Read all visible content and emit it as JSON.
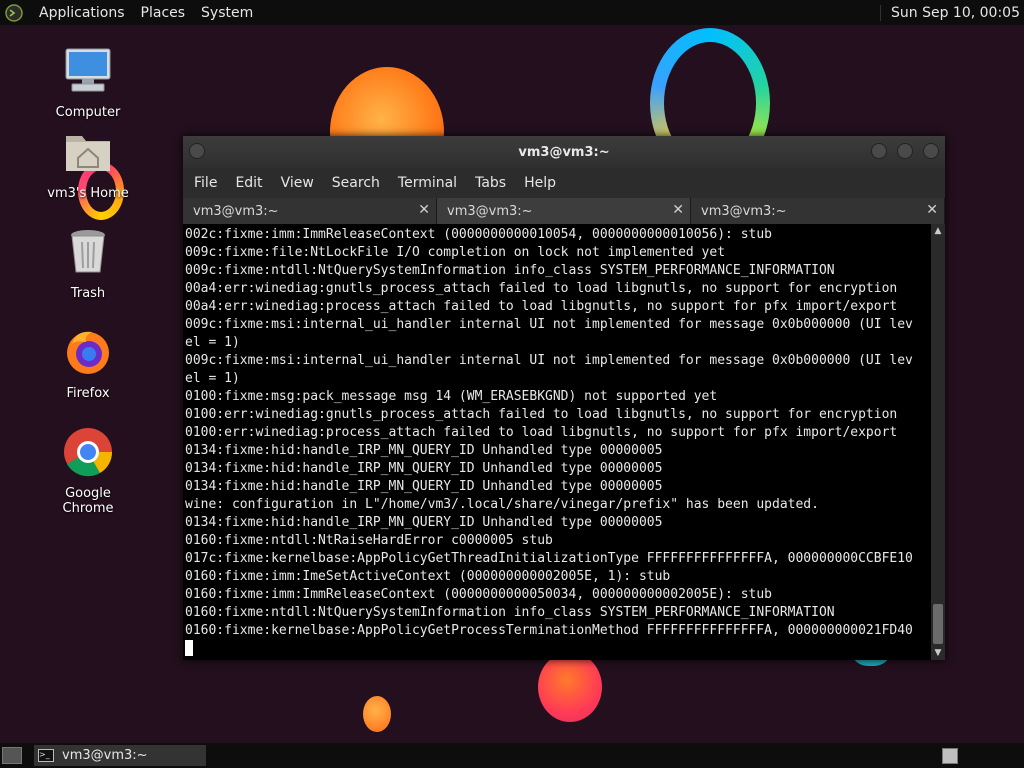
{
  "top_panel": {
    "menus": [
      "Applications",
      "Places",
      "System"
    ],
    "clock": "Sun Sep 10, 00:05"
  },
  "desktop_icons": [
    {
      "label": "Computer",
      "icon": "computer-icon"
    },
    {
      "label": "vm3's Home",
      "icon": "home-folder-icon"
    },
    {
      "label": "Trash",
      "icon": "trash-icon"
    },
    {
      "label": "Firefox",
      "icon": "firefox-icon"
    },
    {
      "label": "Google Chrome",
      "icon": "chrome-icon"
    }
  ],
  "window": {
    "title": "vm3@vm3:~",
    "menus": [
      "File",
      "Edit",
      "View",
      "Search",
      "Terminal",
      "Tabs",
      "Help"
    ],
    "tabs": [
      {
        "label": "vm3@vm3:~",
        "active": false
      },
      {
        "label": "vm3@vm3:~",
        "active": true
      },
      {
        "label": "vm3@vm3:~",
        "active": false
      }
    ],
    "terminal_lines": [
      "002c:fixme:imm:ImmReleaseContext (0000000000010054, 0000000000010056): stub",
      "009c:fixme:file:NtLockFile I/O completion on lock not implemented yet",
      "009c:fixme:ntdll:NtQuerySystemInformation info_class SYSTEM_PERFORMANCE_INFORMATION",
      "00a4:err:winediag:gnutls_process_attach failed to load libgnutls, no support for encryption",
      "00a4:err:winediag:process_attach failed to load libgnutls, no support for pfx import/export",
      "009c:fixme:msi:internal_ui_handler internal UI not implemented for message 0x0b000000 (UI lev",
      "el = 1)",
      "009c:fixme:msi:internal_ui_handler internal UI not implemented for message 0x0b000000 (UI lev",
      "el = 1)",
      "0100:fixme:msg:pack_message msg 14 (WM_ERASEBKGND) not supported yet",
      "0100:err:winediag:gnutls_process_attach failed to load libgnutls, no support for encryption",
      "0100:err:winediag:process_attach failed to load libgnutls, no support for pfx import/export",
      "0134:fixme:hid:handle_IRP_MN_QUERY_ID Unhandled type 00000005",
      "0134:fixme:hid:handle_IRP_MN_QUERY_ID Unhandled type 00000005",
      "0134:fixme:hid:handle_IRP_MN_QUERY_ID Unhandled type 00000005",
      "wine: configuration in L\"/home/vm3/.local/share/vinegar/prefix\" has been updated.",
      "0134:fixme:hid:handle_IRP_MN_QUERY_ID Unhandled type 00000005",
      "0160:fixme:ntdll:NtRaiseHardError c0000005 stub",
      "017c:fixme:kernelbase:AppPolicyGetThreadInitializationType FFFFFFFFFFFFFFFA, 000000000CCBFE10",
      "0160:fixme:imm:ImeSetActiveContext (000000000002005E, 1): stub",
      "0160:fixme:imm:ImmReleaseContext (0000000000050034, 000000000002005E): stub",
      "0160:fixme:ntdll:NtQuerySystemInformation info_class SYSTEM_PERFORMANCE_INFORMATION",
      "0160:fixme:kernelbase:AppPolicyGetProcessTerminationMethod FFFFFFFFFFFFFFFA, 000000000021FD40"
    ]
  },
  "taskbar": {
    "task_label": "vm3@vm3:~"
  }
}
